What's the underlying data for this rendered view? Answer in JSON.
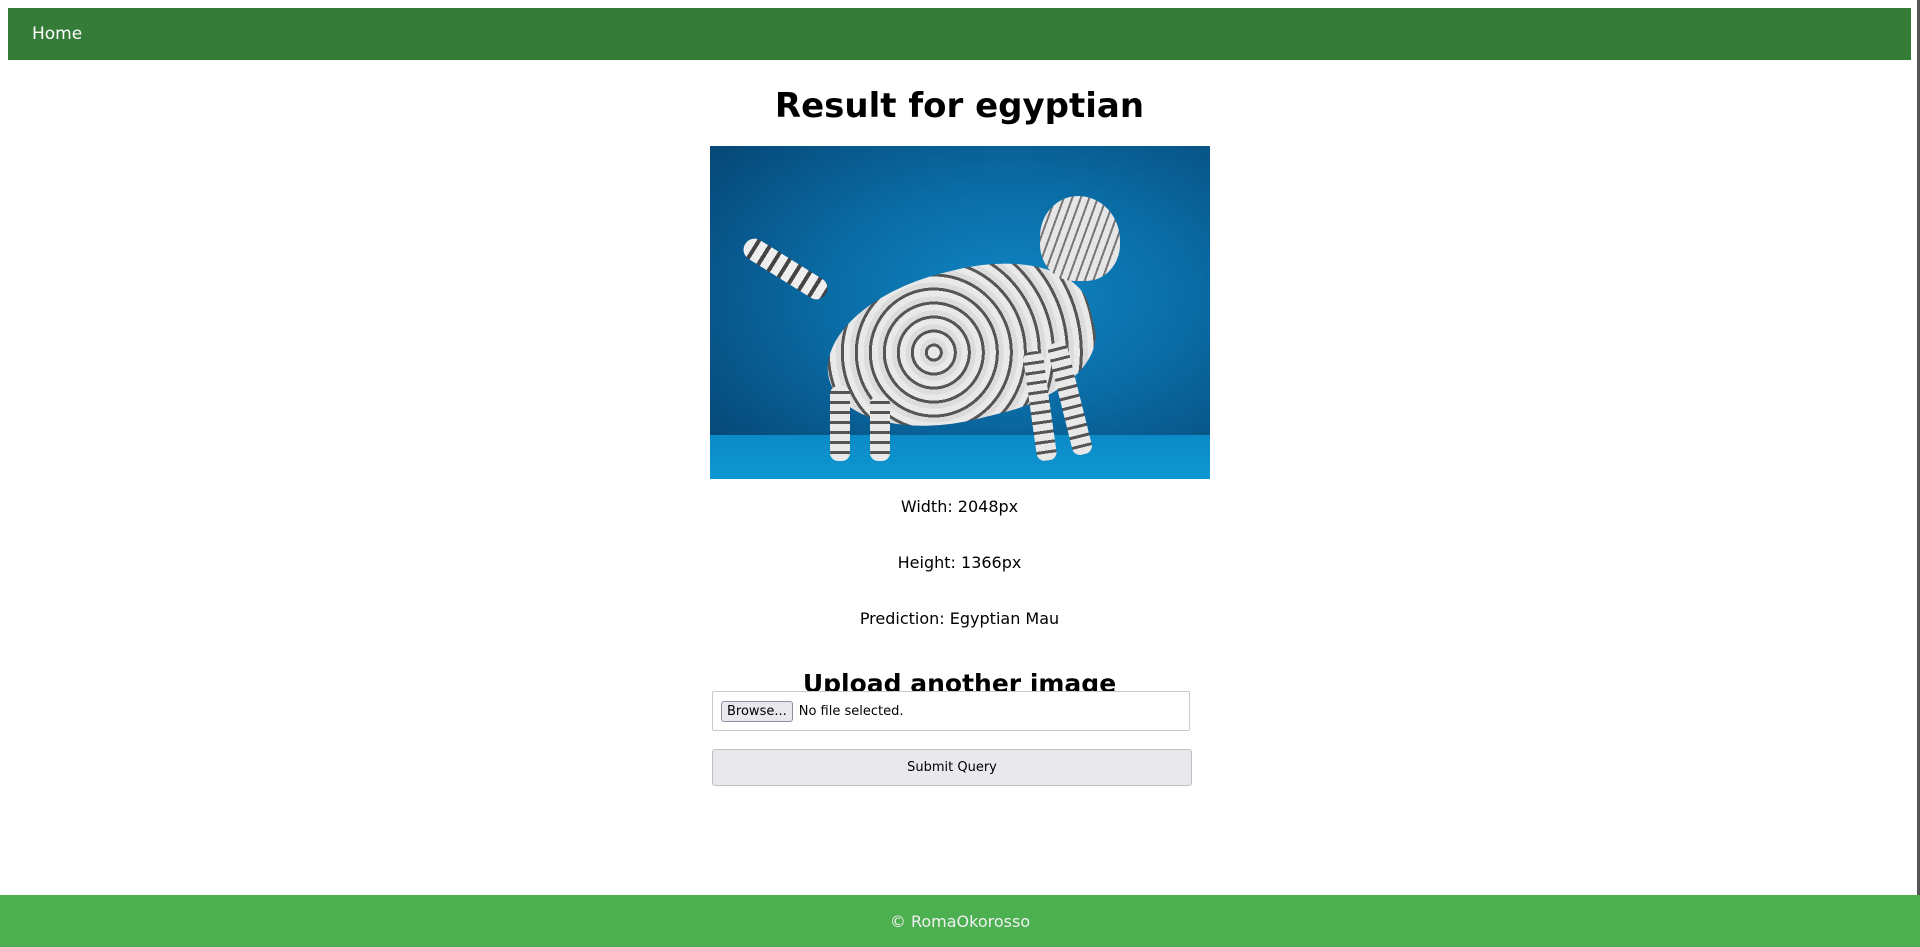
{
  "nav": {
    "home_label": "Home"
  },
  "result": {
    "title": "Result for egyptian",
    "width_text": "Width: 2048px",
    "height_text": "Height: 1366px",
    "prediction_text": "Prediction: Egyptian Mau"
  },
  "upload": {
    "heading": "Upload another image",
    "browse_label": "Browse...",
    "file_status": "No file selected.",
    "submit_label": "Submit Query"
  },
  "footer": {
    "text": "© RomaOkorosso"
  },
  "colors": {
    "navbar": "#367c39",
    "footer": "#4caf50"
  }
}
